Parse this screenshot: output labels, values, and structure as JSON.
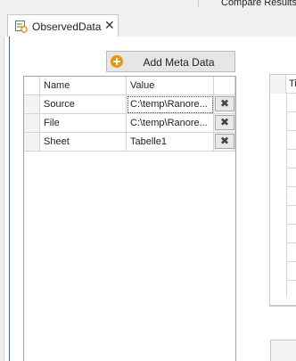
{
  "top": {
    "compare_results": "Compare Results"
  },
  "tab": {
    "title": "ObservedData",
    "close": "✕",
    "icon": "observed-data-icon"
  },
  "toolbar": {
    "add_meta_label": "Add Meta Data",
    "add_icon": "plus-circle-icon"
  },
  "meta_grid": {
    "columns": [
      "Name",
      "Value"
    ],
    "rows": [
      {
        "name": "Source",
        "value": "C:\\temp\\Ranore...",
        "delete": "✖"
      },
      {
        "name": "File",
        "value": "C:\\temp\\Ranore...",
        "delete": "✖"
      },
      {
        "name": "Sheet",
        "value": "Tabelle1",
        "delete": "✖"
      }
    ]
  },
  "right_grid": {
    "header_partial": "Ti"
  },
  "colors": {
    "accent": "#3c5aa6",
    "add_icon": "#e8950f"
  }
}
